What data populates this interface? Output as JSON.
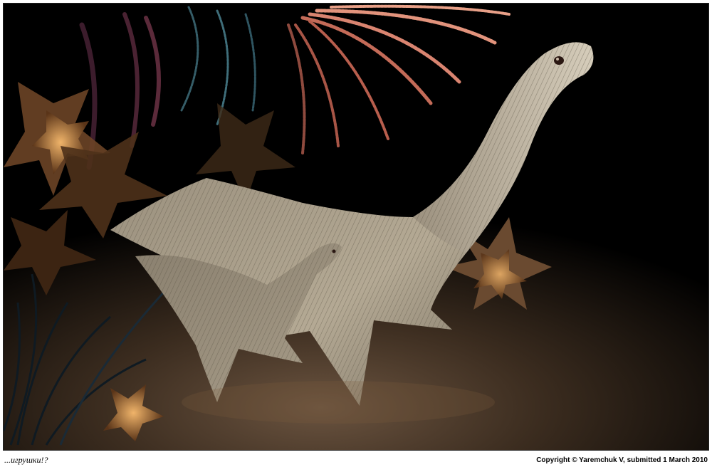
{
  "image": {
    "subject": "render",
    "palette": {
      "background": "#000000",
      "floor": "#5a4632",
      "creature": "#b9ad98",
      "star": "#c88a4a",
      "frond_red": "#d07a66",
      "frond_blue": "#3f6e7a"
    }
  },
  "caption": {
    "title": "...игрушки!?",
    "credit": "Copyright © Yaremchuk V, submitted 1 March 2010"
  }
}
